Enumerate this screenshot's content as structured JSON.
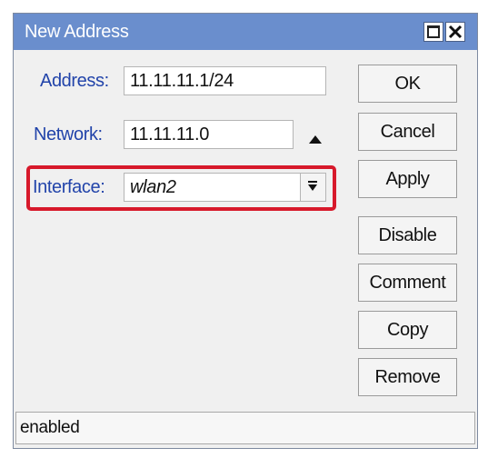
{
  "window": {
    "title": "New Address",
    "maximize_icon": "maximize-icon",
    "close_icon": "close-icon"
  },
  "form": {
    "address_label": "Address:",
    "address_value": "11.11.11.1/24",
    "network_label": "Network:",
    "network_value": "11.11.11.0",
    "network_toggle_icon": "triangle-up-icon",
    "interface_label": "Interface:",
    "interface_value": "wlan2",
    "interface_dropdown_icon": "dropdown-arrow-icon"
  },
  "buttons": {
    "ok": "OK",
    "cancel": "Cancel",
    "apply": "Apply",
    "disable": "Disable",
    "comment": "Comment",
    "copy": "Copy",
    "remove": "Remove"
  },
  "status": {
    "text": "enabled"
  },
  "colors": {
    "titlebar": "#6a8ecd",
    "label": "#2244aa",
    "highlight": "#d7192b"
  }
}
